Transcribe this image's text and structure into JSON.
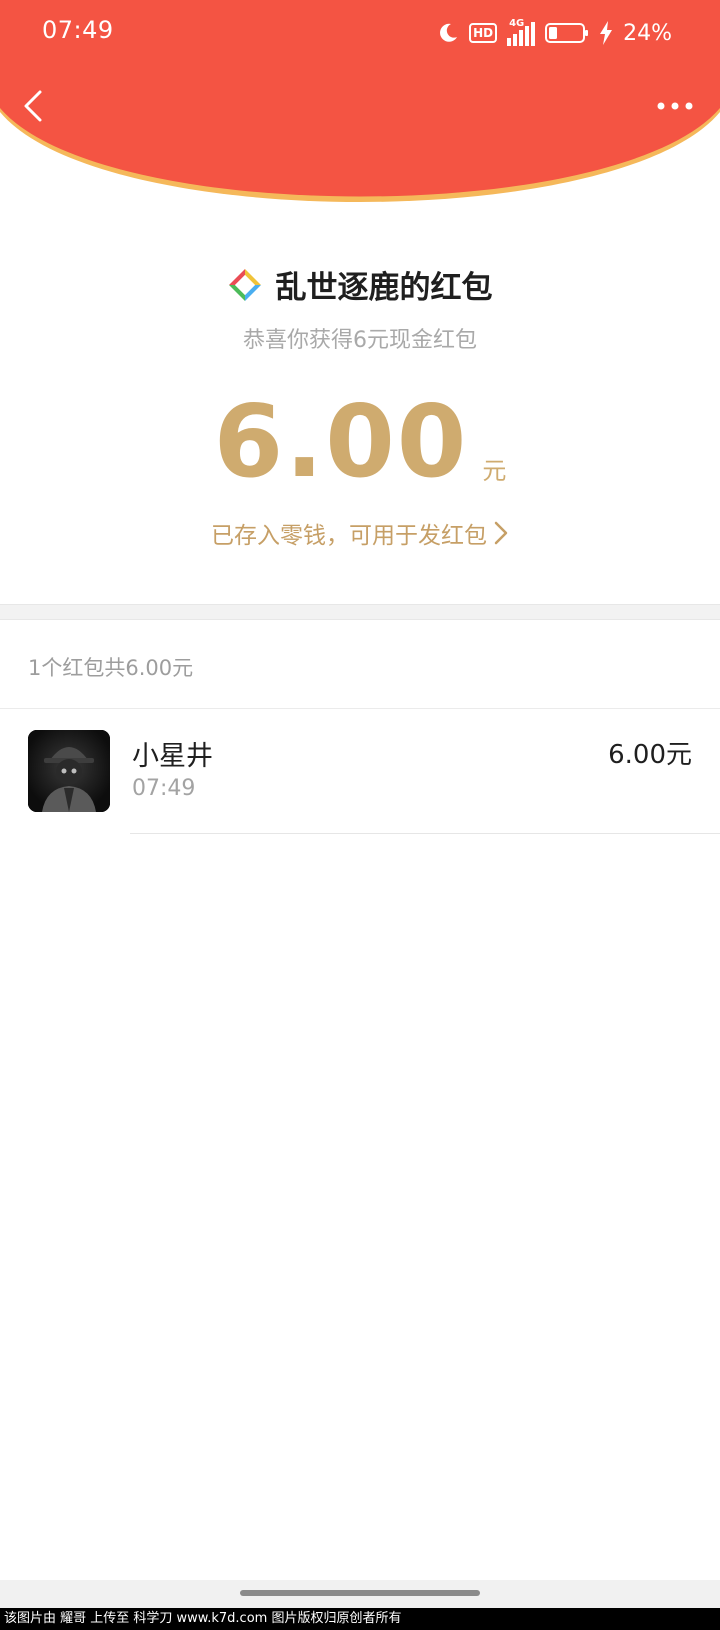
{
  "status_bar": {
    "time": "07:49",
    "hd": "HD",
    "network": "4G",
    "battery_percent": "24%"
  },
  "colors": {
    "header_red": "#f45443",
    "header_border": "#f5b85a",
    "gold": "#cfab6f"
  },
  "icons": {
    "back": "chevron-left-icon",
    "more": "more-dots-icon",
    "sender": "colorful-diamond-logo-icon"
  },
  "packet": {
    "sender_title": "乱世逐鹿的红包",
    "greeting": "恭喜你获得6元现金红包",
    "amount": "6.00",
    "unit": "元",
    "saved_link": "已存入零钱，可用于发红包"
  },
  "summary": "1个红包共6.00元",
  "records": [
    {
      "name": "小星井",
      "time": "07:49",
      "amount": "6.00元"
    }
  ],
  "watermark": "该图片由 耀哥 上传至 科学刀 www.k7d.com 图片版权归原创者所有"
}
